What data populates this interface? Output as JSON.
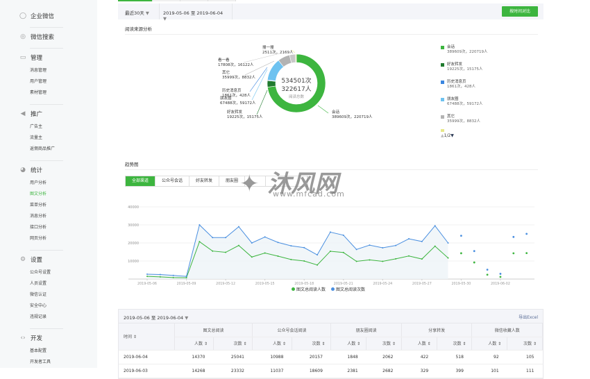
{
  "sidebar": {
    "sections": [
      {
        "label": "企业微信",
        "icon": "enterprise-wechat-icon",
        "items": []
      },
      {
        "label": "微信搜索",
        "icon": "search-icon",
        "items": []
      },
      {
        "label": "管理",
        "icon": "inbox-icon",
        "items": [
          "消息管理",
          "用户管理",
          "素材管理"
        ]
      },
      {
        "label": "推广",
        "icon": "megaphone-icon",
        "items": [
          "广告主",
          "流量主",
          "返佣商品推广"
        ]
      },
      {
        "label": "统计",
        "icon": "pie-chart-icon",
        "items": [
          "用户分析",
          "图文分析",
          "菜单分析",
          "消息分析",
          "接口分析",
          "网页分析"
        ]
      },
      {
        "label": "设置",
        "icon": "gear-icon",
        "items": [
          "公众号设置",
          "人员设置",
          "微信认证",
          "安全中心",
          "违规记录"
        ]
      },
      {
        "label": "开发",
        "icon": "code-icon",
        "items": [
          "基本配置",
          "开发者工具"
        ]
      }
    ],
    "active_item": "图文分析"
  },
  "filter": {
    "range": "最近30天",
    "date_range": "2019-05-06 至 2019-06-04",
    "compare_button": "按时间对比"
  },
  "source": {
    "title": "阅读来源分析",
    "total_reads": "534501次",
    "total_users": "322617人",
    "center_caption": "阅读总数",
    "slices": [
      {
        "name": "会话",
        "reads": 389609,
        "users": 220719,
        "text": "389609次，220719人",
        "color": "#3db53f"
      },
      {
        "name": "好友转发",
        "reads": 19225,
        "users": 15175,
        "text": "19225次，15175人",
        "color": "#1f7a2e"
      },
      {
        "name": "历史消息页",
        "reads": 1861,
        "users": 428,
        "text": "1861次，428人",
        "color": "#3b86e0"
      },
      {
        "name": "朋友圈",
        "reads": 67488,
        "users": 59172,
        "text": "67488次，59172人",
        "color": "#6ec2f0"
      },
      {
        "name": "其它",
        "reads": 35999,
        "users": 8832,
        "text": "35999次，8832人",
        "color": "#b3b3b3"
      },
      {
        "name": "看一看",
        "reads": 17808,
        "users": 16122,
        "text": "17808次，16122人",
        "color": "#c8c8c8"
      },
      {
        "name": "搜一搜",
        "reads": 2511,
        "users": 2169,
        "text": "2511次，2169人",
        "color": "#e8e88a"
      }
    ],
    "legend_pager": "1/2"
  },
  "trend": {
    "title": "趋势图",
    "tabs": [
      "全部渠道",
      "公众号会话",
      "好友转发",
      "朋友圈"
    ],
    "active_tab": "全部渠道"
  },
  "chart_data": {
    "type": "line",
    "x": [
      "2019-05-06",
      "2019-05-07",
      "2019-05-08",
      "2019-05-09",
      "2019-05-10",
      "2019-05-11",
      "2019-05-12",
      "2019-05-13",
      "2019-05-14",
      "2019-05-15",
      "2019-05-16",
      "2019-05-17",
      "2019-05-18",
      "2019-05-19",
      "2019-05-20",
      "2019-05-21",
      "2019-05-22",
      "2019-05-23",
      "2019-05-24",
      "2019-05-25",
      "2019-05-26",
      "2019-05-27",
      "2019-05-28",
      "2019-05-29",
      "2019-05-30",
      "2019-05-31",
      "2019-06-01",
      "2019-06-02",
      "2019-06-03",
      "2019-06-04"
    ],
    "xticks": [
      "2019-05-06",
      "2019-05-09",
      "2019-05-12",
      "2019-05-15",
      "2019-05-18",
      "2019-05-21",
      "2019-05-24",
      "2019-05-27",
      "2019-05-30",
      "2019-06-02"
    ],
    "yticks": [
      "10000",
      "20000",
      "30000",
      "40000"
    ],
    "ylim": [
      0,
      40000
    ],
    "grid": true,
    "legend": "bottom",
    "series": [
      {
        "name": "图文总阅读人数",
        "color": "#3db53f",
        "values": [
          1500,
          1200,
          800,
          700,
          20700,
          15500,
          14800,
          18600,
          12200,
          14400,
          12700,
          10800,
          10000,
          7800,
          15400,
          14700,
          9800,
          10600,
          9800,
          11200,
          12800,
          11100,
          18200,
          11700,
          14300,
          9200,
          2400,
          1200,
          14268,
          14370
        ]
      },
      {
        "name": "图文总阅读次数",
        "color": "#4a8fe0",
        "values": [
          2700,
          2500,
          2000,
          1500,
          30000,
          23000,
          23000,
          29000,
          20000,
          23300,
          20300,
          18400,
          17400,
          13400,
          26000,
          24300,
          16400,
          18800,
          17300,
          18600,
          22300,
          20800,
          29500,
          20000,
          24000,
          15500,
          5200,
          2900,
          23332,
          25041
        ]
      }
    ]
  },
  "table": {
    "date_range": "2019-05-06 至 2019-06-04",
    "export": "导出Excel",
    "time_header": "时间 ⇕",
    "groups": [
      "图文总阅读",
      "公众号会话阅读",
      "朋友圈阅读",
      "分享转发",
      "微信收藏人数"
    ],
    "sub": [
      "人数 ⇕",
      "次数 ⇕"
    ],
    "rows": [
      [
        "2019-06-04",
        "14370",
        "25041",
        "10988",
        "20157",
        "1848",
        "2062",
        "422",
        "518",
        "92",
        "105"
      ],
      [
        "2019-06-03",
        "14268",
        "23332",
        "11037",
        "18609",
        "2381",
        "2682",
        "329",
        "399",
        "101",
        "111"
      ]
    ]
  }
}
